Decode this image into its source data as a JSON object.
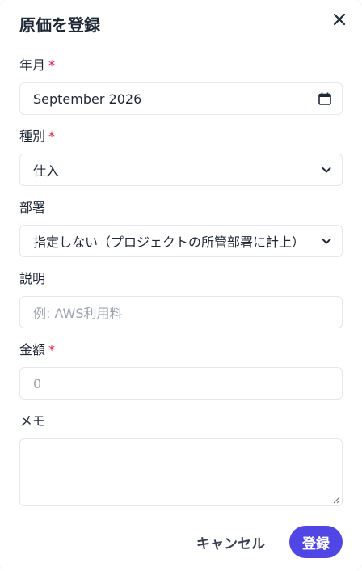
{
  "modal": {
    "title": "原価を登録",
    "close_icon": "close-icon"
  },
  "fields": {
    "year_month": {
      "label": "年月",
      "required_mark": "*",
      "value": "September 2026",
      "icon": "calendar-icon"
    },
    "type": {
      "label": "種別",
      "required_mark": "*",
      "value": "仕入",
      "icon": "chevron-down-icon"
    },
    "department": {
      "label": "部署",
      "value": "指定しない（プロジェクトの所管部署に計上）",
      "icon": "chevron-down-icon"
    },
    "description": {
      "label": "説明",
      "placeholder": "例: AWS利用料"
    },
    "amount": {
      "label": "金額",
      "required_mark": "*",
      "placeholder": "0"
    },
    "memo": {
      "label": "メモ",
      "value": ""
    }
  },
  "actions": {
    "cancel_label": "キャンセル",
    "submit_label": "登録"
  },
  "colors": {
    "primary": "#4f46e5",
    "required": "#e11d48",
    "border": "#e5e7eb",
    "placeholder": "#9ca3af"
  }
}
